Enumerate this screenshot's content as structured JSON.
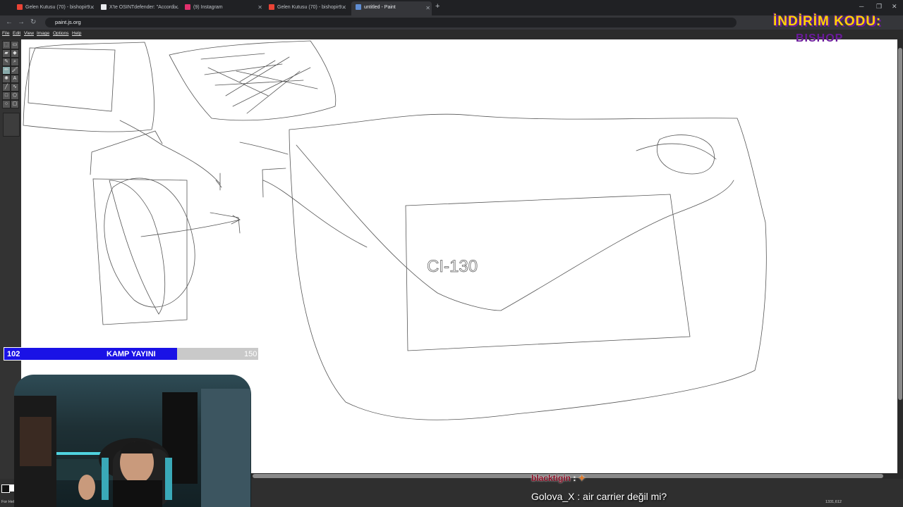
{
  "browser": {
    "tabs": [
      {
        "label": "Gelen Kutusu (70) - bishopir9...",
        "favicon_color": "#ea4335"
      },
      {
        "label": "X'te OSINTdefender: \"Accordi...",
        "favicon_color": "#e8eaed"
      },
      {
        "label": "(9) Instagram",
        "favicon_color": "#e1306c"
      },
      {
        "label": "Gelen Kutusu (70) - bishopir9...",
        "favicon_color": "#ea4335"
      },
      {
        "label": "untitled - Paint",
        "favicon_color": "#5f8dd3",
        "active": true
      }
    ],
    "url": "paint.js.org"
  },
  "app": {
    "menus": [
      "File",
      "Edit",
      "View",
      "Image",
      "Options",
      "Help"
    ],
    "canvas_text": "CI-130",
    "status_help": "For Help, click H...",
    "status_coords": "1331,612"
  },
  "overlay": {
    "progress": {
      "current": "102",
      "label": "KAMP YAYINI",
      "max": "150",
      "fraction": 0.68
    },
    "chat": [
      {
        "user": "blacktigin",
        "separator": ":",
        "message": ""
      },
      {
        "user": "Golova_X",
        "separator": ":",
        "message": "air carrier değil mi?"
      }
    ],
    "promo": {
      "line1": "İNDİRİM KODU:",
      "line2": "BISHOP"
    }
  },
  "colors": {
    "progress_fill": "#1a12e6",
    "progress_track": "#c9c9c9"
  }
}
